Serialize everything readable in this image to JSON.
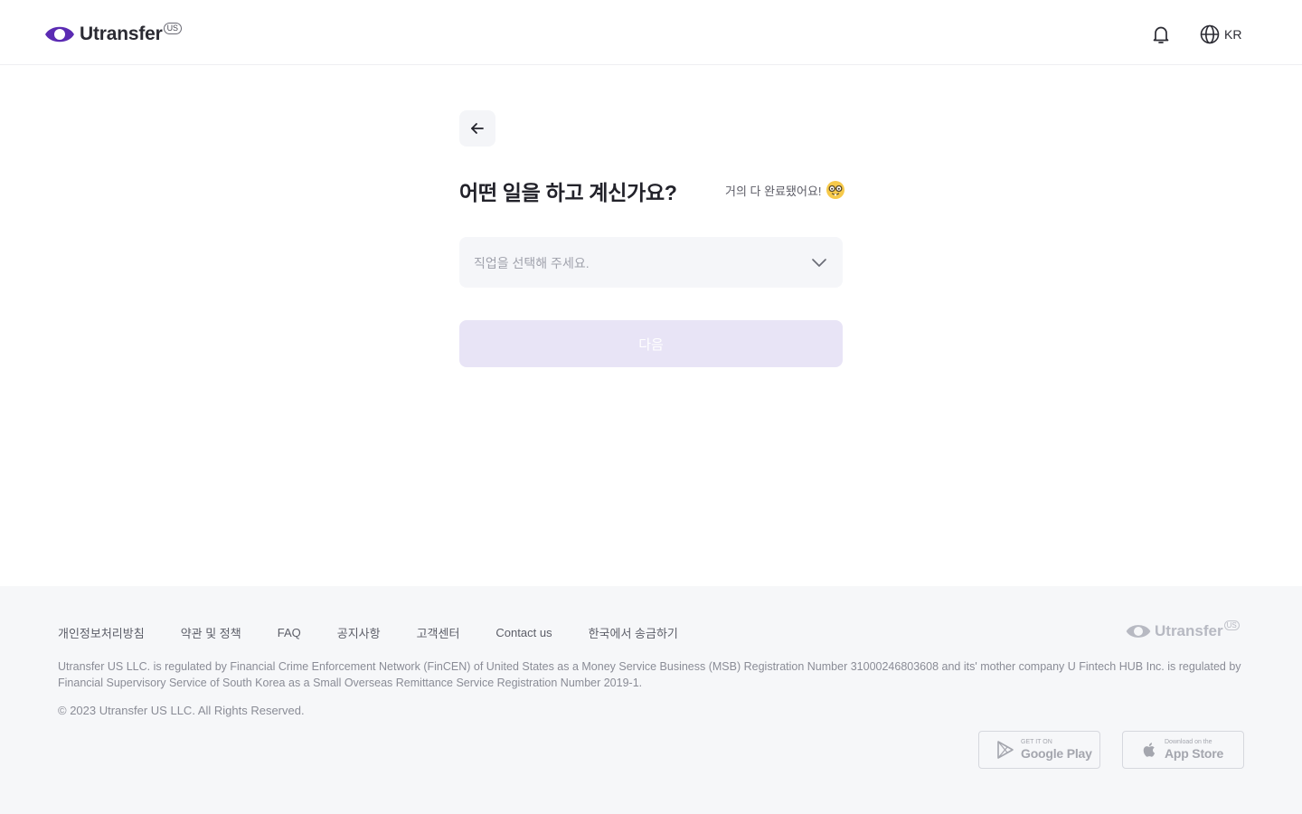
{
  "header": {
    "brand": "Utransfer",
    "brand_badge": "US",
    "language": "KR"
  },
  "main": {
    "title": "어떤 일을 하고 계신가요?",
    "progress_note": "거의 다 완료됐어요!",
    "occupation_select": {
      "placeholder": "직업을 선택해 주세요."
    },
    "next_label": "다음"
  },
  "footer": {
    "links": [
      "개인정보처리방침",
      "약관 및 정책",
      "FAQ",
      "공지사항",
      "고객센터",
      "Contact us",
      "한국에서 송금하기"
    ],
    "brand": "Utransfer",
    "brand_badge": "US",
    "legal": "Utransfer US LLC. is regulated by Financial Crime Enforcement Network (FinCEN) of United States as a Money Service Business (MSB) Registration Number 31000246803608 and its' mother company U Fintech HUB Inc. is regulated by Financial Supervisory Service of South Korea as a Small Overseas Remittance Service Registration Number 2019-1.",
    "copyright": "© 2023 Utransfer US LLC. All Rights Reserved.",
    "google_play": {
      "small": "GET IT ON",
      "big": "Google Play"
    },
    "app_store": {
      "small": "Download on the",
      "big": "App Store"
    }
  },
  "colors": {
    "brand_purple": "#5b2bb3",
    "button_disabled": "#e8e4f6",
    "footer_bg": "#f6f7f9"
  }
}
